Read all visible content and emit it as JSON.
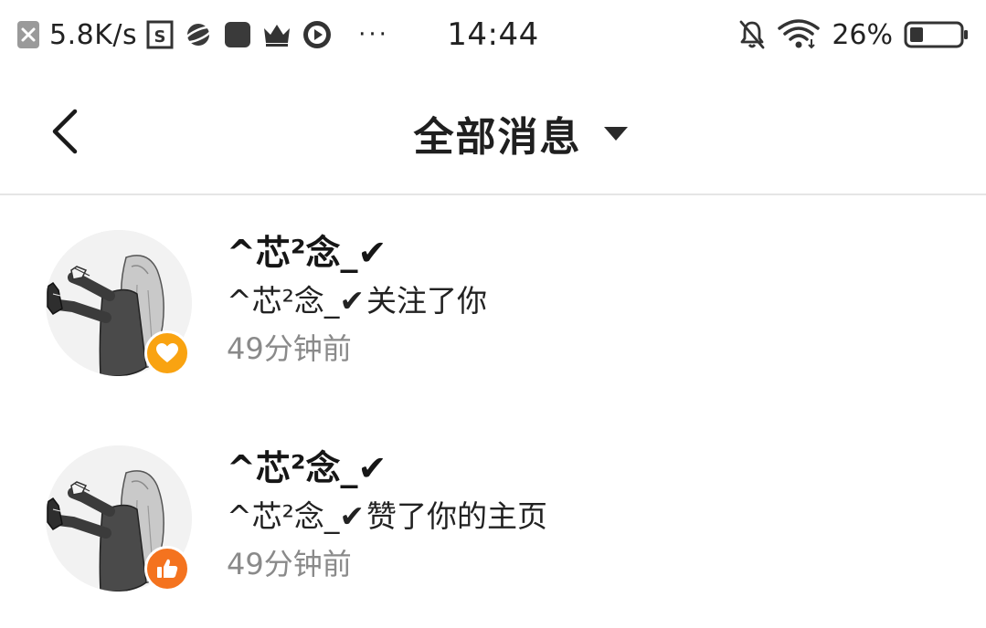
{
  "status_bar": {
    "net_speed": "5.8K/s",
    "time": "14:44",
    "battery_percent": "26%",
    "battery_level": 0.26,
    "more_dots": "···",
    "icons": [
      "close-box-icon",
      "screenshot-icon",
      "planet-icon",
      "square-app-icon",
      "crown-icon",
      "play-circle-icon",
      "bell-off-icon",
      "wifi-icon",
      "battery-icon"
    ]
  },
  "nav": {
    "title": "全部消息",
    "back_icon": "chevron-left-icon",
    "dropdown_icon": "caret-down-icon"
  },
  "messages": [
    {
      "name": "^芯²念_✔",
      "sender": "^芯²念_✔",
      "action": "关注了你",
      "time": "49分钟前",
      "badge_icon": "heart-icon",
      "badge_color": "#f9a311"
    },
    {
      "name": "^芯²念_✔",
      "sender": "^芯²念_✔",
      "action": "赞了你的主页",
      "time": "49分钟前",
      "badge_icon": "thumbs-up-icon",
      "badge_color": "#f4731f"
    }
  ]
}
